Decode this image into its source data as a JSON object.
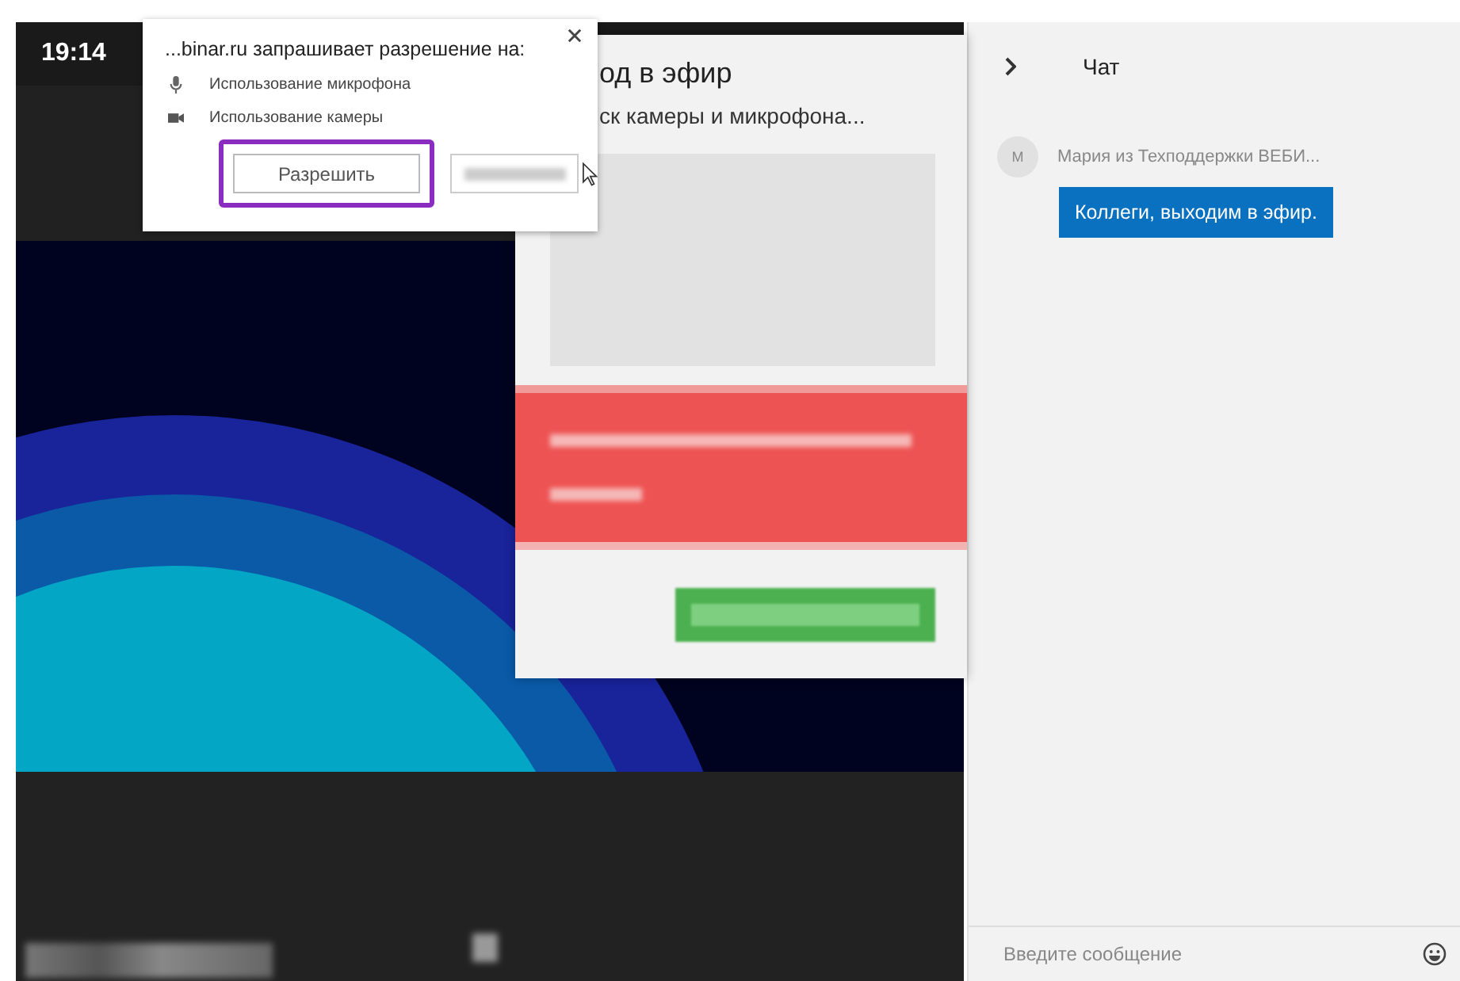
{
  "time": "19:14",
  "permission_popup": {
    "title": "...binar.ru запрашивает разрешение на:",
    "items": [
      {
        "kind": "microphone",
        "label": "Использование микрофона"
      },
      {
        "kind": "camera",
        "label": "Использование камеры"
      }
    ],
    "allow_button": "Разрешить",
    "highlighted": true
  },
  "modal": {
    "title": "од в эфир",
    "subtitle": "ск камеры и микрофона..."
  },
  "chat": {
    "title": "Чат",
    "messages": [
      {
        "avatar": "М",
        "sender": "Мария из Техподдержки ВЕБИ...",
        "text": "Коллеги, выходим в эфир."
      }
    ],
    "input": {
      "placeholder": "Введите сообщение"
    }
  }
}
